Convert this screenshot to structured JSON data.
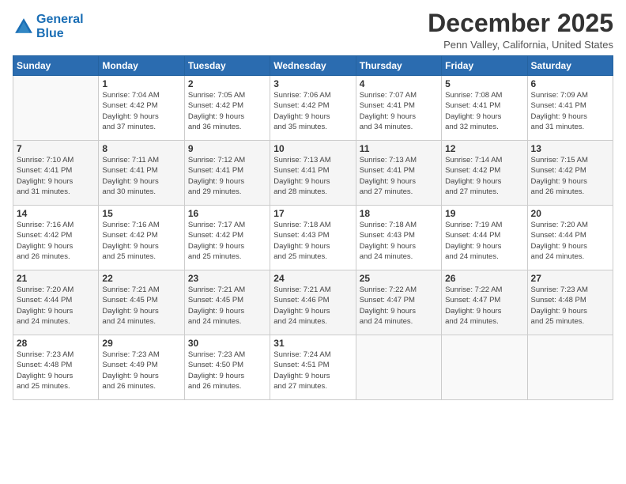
{
  "logo": {
    "line1": "General",
    "line2": "Blue"
  },
  "title": "December 2025",
  "subtitle": "Penn Valley, California, United States",
  "days_header": [
    "Sunday",
    "Monday",
    "Tuesday",
    "Wednesday",
    "Thursday",
    "Friday",
    "Saturday"
  ],
  "weeks": [
    [
      {
        "day": "",
        "info": ""
      },
      {
        "day": "1",
        "info": "Sunrise: 7:04 AM\nSunset: 4:42 PM\nDaylight: 9 hours\nand 37 minutes."
      },
      {
        "day": "2",
        "info": "Sunrise: 7:05 AM\nSunset: 4:42 PM\nDaylight: 9 hours\nand 36 minutes."
      },
      {
        "day": "3",
        "info": "Sunrise: 7:06 AM\nSunset: 4:42 PM\nDaylight: 9 hours\nand 35 minutes."
      },
      {
        "day": "4",
        "info": "Sunrise: 7:07 AM\nSunset: 4:41 PM\nDaylight: 9 hours\nand 34 minutes."
      },
      {
        "day": "5",
        "info": "Sunrise: 7:08 AM\nSunset: 4:41 PM\nDaylight: 9 hours\nand 32 minutes."
      },
      {
        "day": "6",
        "info": "Sunrise: 7:09 AM\nSunset: 4:41 PM\nDaylight: 9 hours\nand 31 minutes."
      }
    ],
    [
      {
        "day": "7",
        "info": "Sunrise: 7:10 AM\nSunset: 4:41 PM\nDaylight: 9 hours\nand 31 minutes."
      },
      {
        "day": "8",
        "info": "Sunrise: 7:11 AM\nSunset: 4:41 PM\nDaylight: 9 hours\nand 30 minutes."
      },
      {
        "day": "9",
        "info": "Sunrise: 7:12 AM\nSunset: 4:41 PM\nDaylight: 9 hours\nand 29 minutes."
      },
      {
        "day": "10",
        "info": "Sunrise: 7:13 AM\nSunset: 4:41 PM\nDaylight: 9 hours\nand 28 minutes."
      },
      {
        "day": "11",
        "info": "Sunrise: 7:13 AM\nSunset: 4:41 PM\nDaylight: 9 hours\nand 27 minutes."
      },
      {
        "day": "12",
        "info": "Sunrise: 7:14 AM\nSunset: 4:42 PM\nDaylight: 9 hours\nand 27 minutes."
      },
      {
        "day": "13",
        "info": "Sunrise: 7:15 AM\nSunset: 4:42 PM\nDaylight: 9 hours\nand 26 minutes."
      }
    ],
    [
      {
        "day": "14",
        "info": "Sunrise: 7:16 AM\nSunset: 4:42 PM\nDaylight: 9 hours\nand 26 minutes."
      },
      {
        "day": "15",
        "info": "Sunrise: 7:16 AM\nSunset: 4:42 PM\nDaylight: 9 hours\nand 25 minutes."
      },
      {
        "day": "16",
        "info": "Sunrise: 7:17 AM\nSunset: 4:42 PM\nDaylight: 9 hours\nand 25 minutes."
      },
      {
        "day": "17",
        "info": "Sunrise: 7:18 AM\nSunset: 4:43 PM\nDaylight: 9 hours\nand 25 minutes."
      },
      {
        "day": "18",
        "info": "Sunrise: 7:18 AM\nSunset: 4:43 PM\nDaylight: 9 hours\nand 24 minutes."
      },
      {
        "day": "19",
        "info": "Sunrise: 7:19 AM\nSunset: 4:44 PM\nDaylight: 9 hours\nand 24 minutes."
      },
      {
        "day": "20",
        "info": "Sunrise: 7:20 AM\nSunset: 4:44 PM\nDaylight: 9 hours\nand 24 minutes."
      }
    ],
    [
      {
        "day": "21",
        "info": "Sunrise: 7:20 AM\nSunset: 4:44 PM\nDaylight: 9 hours\nand 24 minutes."
      },
      {
        "day": "22",
        "info": "Sunrise: 7:21 AM\nSunset: 4:45 PM\nDaylight: 9 hours\nand 24 minutes."
      },
      {
        "day": "23",
        "info": "Sunrise: 7:21 AM\nSunset: 4:45 PM\nDaylight: 9 hours\nand 24 minutes."
      },
      {
        "day": "24",
        "info": "Sunrise: 7:21 AM\nSunset: 4:46 PM\nDaylight: 9 hours\nand 24 minutes."
      },
      {
        "day": "25",
        "info": "Sunrise: 7:22 AM\nSunset: 4:47 PM\nDaylight: 9 hours\nand 24 minutes."
      },
      {
        "day": "26",
        "info": "Sunrise: 7:22 AM\nSunset: 4:47 PM\nDaylight: 9 hours\nand 24 minutes."
      },
      {
        "day": "27",
        "info": "Sunrise: 7:23 AM\nSunset: 4:48 PM\nDaylight: 9 hours\nand 25 minutes."
      }
    ],
    [
      {
        "day": "28",
        "info": "Sunrise: 7:23 AM\nSunset: 4:48 PM\nDaylight: 9 hours\nand 25 minutes."
      },
      {
        "day": "29",
        "info": "Sunrise: 7:23 AM\nSunset: 4:49 PM\nDaylight: 9 hours\nand 26 minutes."
      },
      {
        "day": "30",
        "info": "Sunrise: 7:23 AM\nSunset: 4:50 PM\nDaylight: 9 hours\nand 26 minutes."
      },
      {
        "day": "31",
        "info": "Sunrise: 7:24 AM\nSunset: 4:51 PM\nDaylight: 9 hours\nand 27 minutes."
      },
      {
        "day": "",
        "info": ""
      },
      {
        "day": "",
        "info": ""
      },
      {
        "day": "",
        "info": ""
      }
    ]
  ]
}
